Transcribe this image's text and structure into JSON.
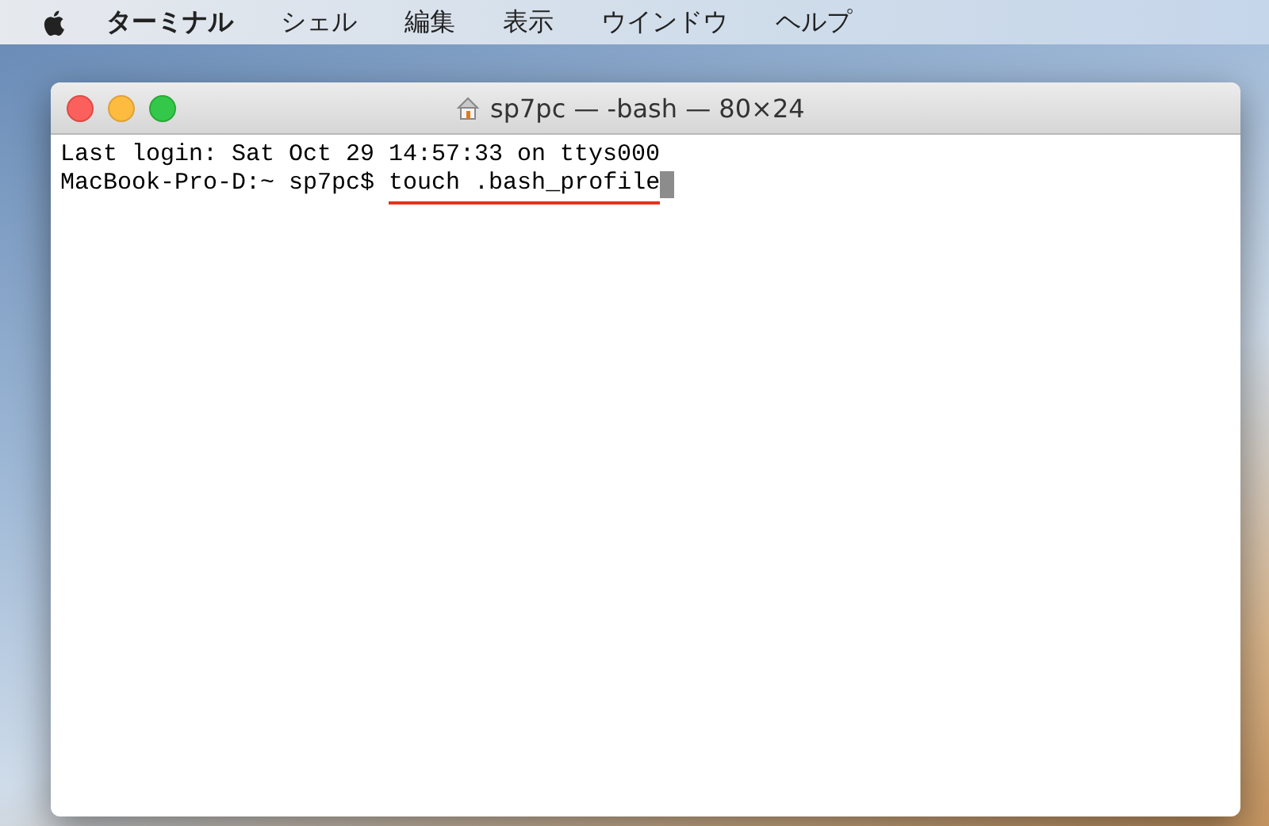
{
  "menu_bar": {
    "items": [
      {
        "label": "ターミナル",
        "kind": "app"
      },
      {
        "label": "シェル",
        "kind": "menu"
      },
      {
        "label": "編集",
        "kind": "menu"
      },
      {
        "label": "表示",
        "kind": "menu"
      },
      {
        "label": "ウインドウ",
        "kind": "menu"
      },
      {
        "label": "ヘルプ",
        "kind": "menu"
      }
    ]
  },
  "window": {
    "title": "sp7pc — -bash — 80×24",
    "lines": [
      {
        "kind": "output",
        "text": "Last login: Sat Oct 29 14:57:33 on ttys000"
      },
      {
        "kind": "prompt",
        "prompt": "MacBook-Pro-D:~ sp7pc$",
        "command": "touch .bash_profile",
        "underlined": true,
        "cursor": true
      }
    ]
  }
}
